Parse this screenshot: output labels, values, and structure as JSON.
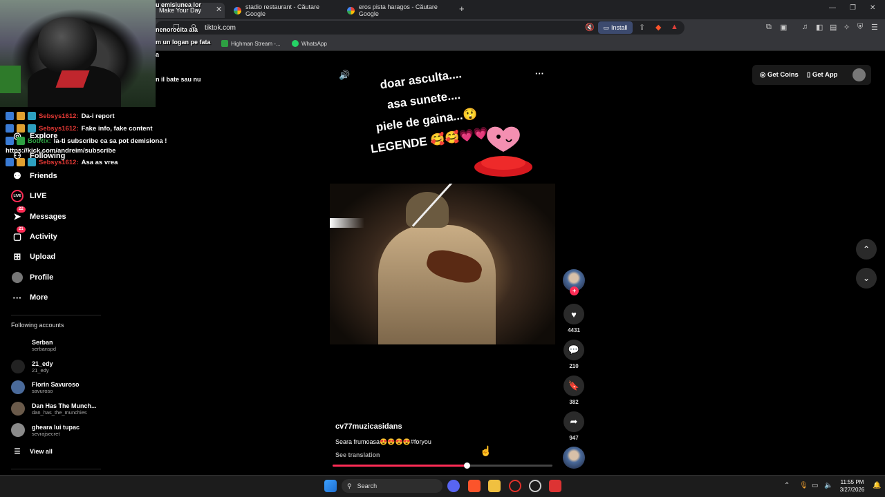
{
  "browser": {
    "tabs": [
      {
        "label": "Make Your Day"
      },
      {
        "label": "stadio restaurant - Căutare Google"
      },
      {
        "label": "eros pista haragos - Căutare Google"
      }
    ],
    "close_tab": "✕",
    "new_tab": "+",
    "window_controls": [
      "—",
      "❐",
      "✕"
    ],
    "url": "tiktok.com",
    "install_label": "Install",
    "bookmarks": [
      {
        "label": "Highman Stream -...",
        "color": "#2ea043"
      },
      {
        "label": "WhatsApp",
        "color": "#25d366"
      }
    ]
  },
  "overlay": {
    "lines": [
      "u emisiunea lor",
      "nenorocita ala",
      "m un logan pe fata",
      "a",
      "n il bate sau nu"
    ]
  },
  "chat": {
    "messages": [
      {
        "user": "Sebsys1612:",
        "text": "Da-i report"
      },
      {
        "user": "Sebsys1612:",
        "text": "Fake info, fake content"
      },
      {
        "user": "BotRix:",
        "text": "la-ti subscribe ca sa pot demisiona !"
      },
      {
        "user": "Sebsys1612:",
        "text": "Asa as vrea"
      }
    ],
    "url_line": "https://kick.com/andreim/subscribe"
  },
  "sidebar": {
    "nav": [
      {
        "label": "Explore",
        "icon": "compass-icon"
      },
      {
        "label": "Following",
        "icon": "following-icon"
      },
      {
        "label": "Friends",
        "icon": "friends-icon"
      },
      {
        "label": "LIVE",
        "icon": "live-icon"
      },
      {
        "label": "Messages",
        "icon": "messages-icon",
        "badge": "22"
      },
      {
        "label": "Activity",
        "icon": "activity-icon",
        "badge": "21"
      },
      {
        "label": "Upload",
        "icon": "upload-icon"
      },
      {
        "label": "Profile",
        "icon": "profile-icon"
      },
      {
        "label": "More",
        "icon": "more-icon"
      }
    ],
    "following_title": "Following accounts",
    "accounts": [
      {
        "name": "Serban",
        "handle": "serbanspd"
      },
      {
        "name": "21_edy",
        "handle": "21_edy"
      },
      {
        "name": "Florin Savuroso",
        "handle": "savuroso"
      },
      {
        "name": "Dan Has The Munch...",
        "handle": "dan_has_the_munchies"
      },
      {
        "name": "gheara lui tupac",
        "handle": "sevrajsecret"
      }
    ],
    "view_all": "View all"
  },
  "video": {
    "caption_lines": [
      "doar asculta....",
      "asa sunete....",
      "piele de gaina...😲",
      "LEGENDE 🥰🥰💗💗"
    ],
    "author": "cv77muzicasidans",
    "description": "Seara frumoasa😍😍😍😍#foryou",
    "see_translation": "See translation",
    "progress": 0.61,
    "likes": "4431",
    "comments": "210",
    "saves": "382",
    "shares": "947"
  },
  "topbar": {
    "get_coins": "Get Coins",
    "get_app": "Get App"
  },
  "taskbar": {
    "search": "Search",
    "time": "11:55 PM",
    "date": "3/27/2026"
  },
  "colors": {
    "accent": "#fe2c55",
    "background": "#000000"
  }
}
